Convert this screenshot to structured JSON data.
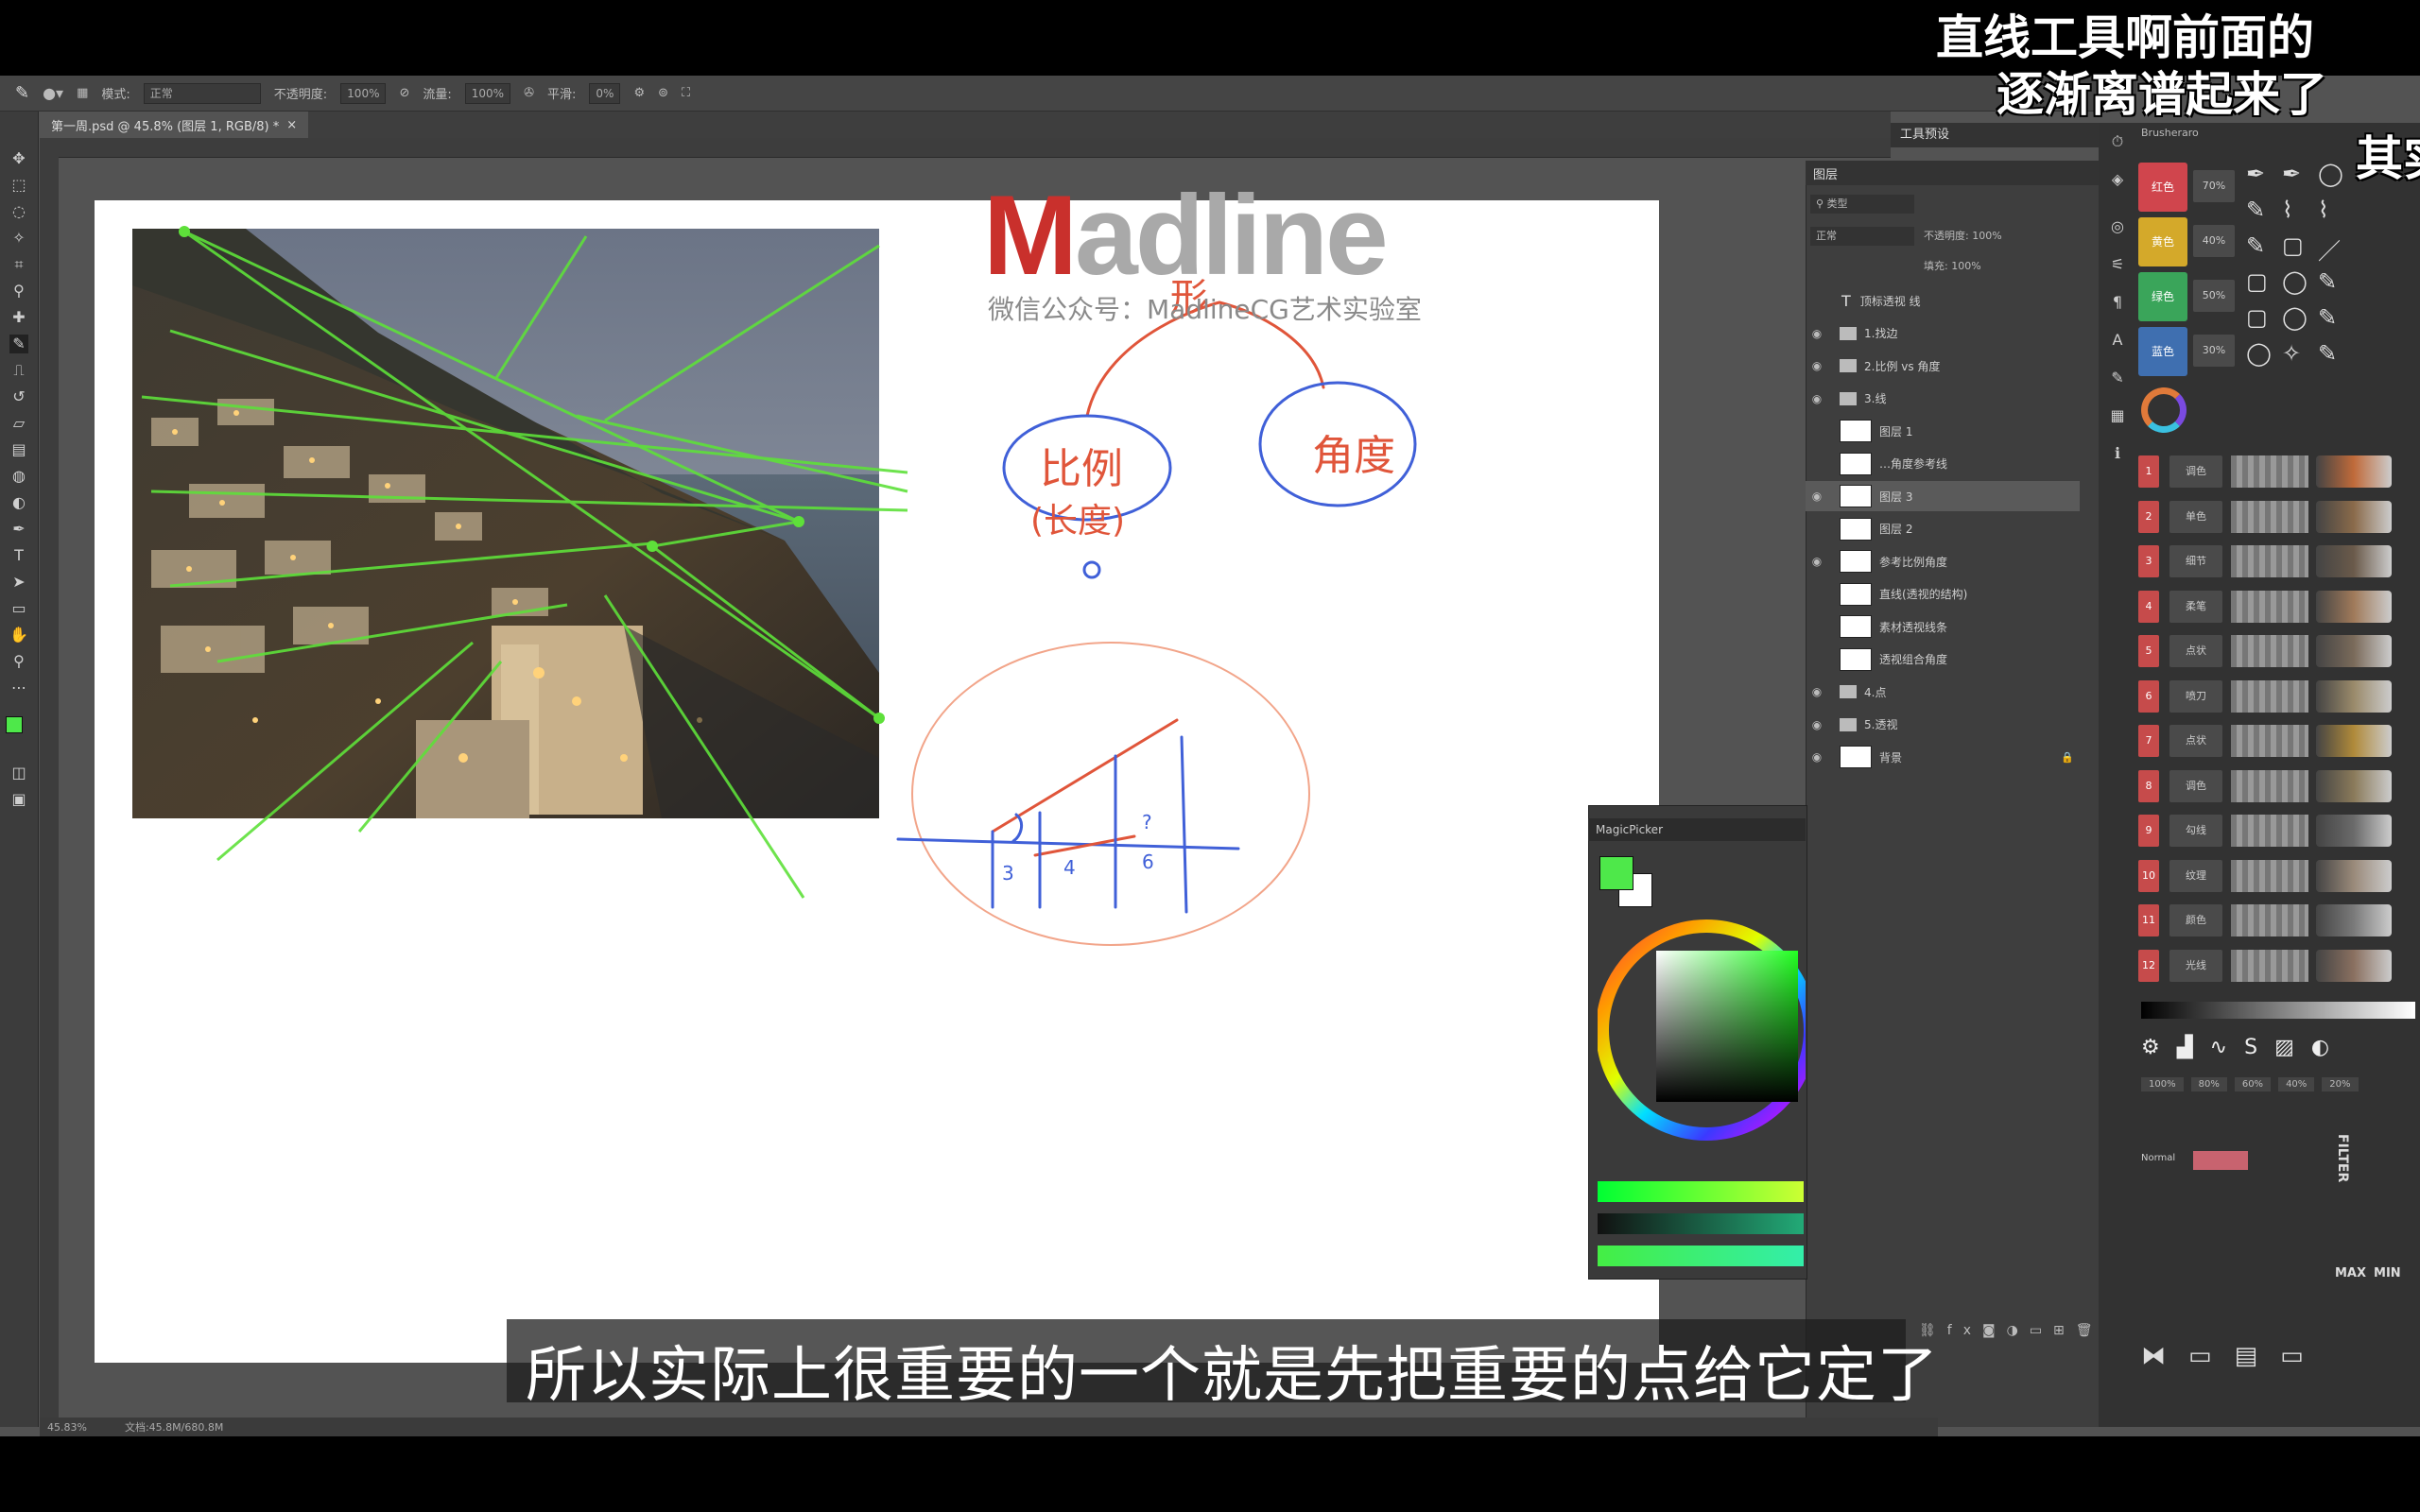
{
  "danmaku": [
    "直线工具啊前面的",
    "逐渐离谱起来了",
    "其实"
  ],
  "subtitle": "所以实际上很重要的一个就是先把重要的点给它定了",
  "watermark": {
    "logo_first": "M",
    "logo_rest": "adline",
    "sub": "微信公众号：MadlineCG艺术实验室"
  },
  "options_bar": {
    "mode_label": "模式:",
    "mode_value": "正常",
    "opacity_label": "不透明度:",
    "opacity_value": "100%",
    "flow_label": "流量:",
    "flow_value": "100%",
    "smooth_label": "平滑:",
    "smooth_value": "0%"
  },
  "document_tab": "第一周.psd @ 45.8% (图层 1, RGB/8) *",
  "status_bar": {
    "zoom": "45.83%",
    "doc": "文档:45.8M/680.8M"
  },
  "workspace_tab": "工具预设",
  "layers_panel": {
    "title": "图层",
    "kind": "类型",
    "blend": "正常",
    "opacity": "不透明度: 100%",
    "fill": "填充: 100%",
    "layers": [
      {
        "name": "顶标透视 线",
        "type": "text",
        "visible": false
      },
      {
        "name": "1.找边",
        "type": "folder",
        "visible": true
      },
      {
        "name": "2.比例 vs 角度",
        "type": "folder",
        "visible": true
      },
      {
        "name": "3.线",
        "type": "folder",
        "visible": true
      },
      {
        "name": "图层 1",
        "type": "layer",
        "visible": false
      },
      {
        "name": "…角度参考线",
        "type": "layer",
        "visible": false
      },
      {
        "name": "图层 3",
        "type": "layer",
        "visible": true,
        "selected": true
      },
      {
        "name": "图层 2",
        "type": "layer",
        "visible": false
      },
      {
        "name": "参考比例角度",
        "type": "layer",
        "visible": true
      },
      {
        "name": "直线(透视的结构)",
        "type": "layer",
        "visible": false
      },
      {
        "name": "素材透视线条",
        "type": "layer",
        "visible": false
      },
      {
        "name": "透视组合角度",
        "type": "layer",
        "visible": false
      },
      {
        "name": "4.点",
        "type": "folder",
        "visible": true
      },
      {
        "name": "5.透视",
        "type": "folder",
        "visible": true
      },
      {
        "name": "背景",
        "type": "layer",
        "visible": true,
        "locked": true
      }
    ]
  },
  "picker": {
    "title": "MagicPicker",
    "fg_color": "#4ee84a",
    "bg_color": "#ffffff"
  },
  "brush_panel": {
    "title": "Brusheraro",
    "swatches": [
      {
        "label": "红色",
        "pct": "70%",
        "color": "#d0454d"
      },
      {
        "label": "黄色",
        "pct": "40%",
        "color": "#d4a92a"
      },
      {
        "label": "绿色",
        "pct": "50%",
        "color": "#3aa55a"
      },
      {
        "label": "蓝色",
        "pct": "30%",
        "color": "#3f6fb0"
      }
    ],
    "brush_rows": [
      {
        "n": "1",
        "name": "调色"
      },
      {
        "n": "2",
        "name": "单色"
      },
      {
        "n": "3",
        "name": "细节"
      },
      {
        "n": "4",
        "name": "柔笔"
      },
      {
        "n": "5",
        "name": "点状"
      },
      {
        "n": "6",
        "name": "喷刀"
      },
      {
        "n": "7",
        "name": "点状"
      },
      {
        "n": "8",
        "name": "调色"
      },
      {
        "n": "9",
        "name": "勾线"
      },
      {
        "n": "10",
        "name": "纹理"
      },
      {
        "n": "11",
        "name": "颜色"
      },
      {
        "n": "12",
        "name": "光线"
      }
    ],
    "filter_label": "FILTER",
    "normal_label": "Normal",
    "max_label": "MAX",
    "min_label": "MIN",
    "pct_row": [
      "100%",
      "80%",
      "60%",
      "40%",
      "20%"
    ]
  },
  "canvas_notes": {
    "top_char": "形",
    "left_bubble": "比例",
    "left_bubble_sub": "(长度)",
    "right_bubble": "角度",
    "zero": "0",
    "n3": "3",
    "n4": "4",
    "n6": "6",
    "q": "?"
  }
}
